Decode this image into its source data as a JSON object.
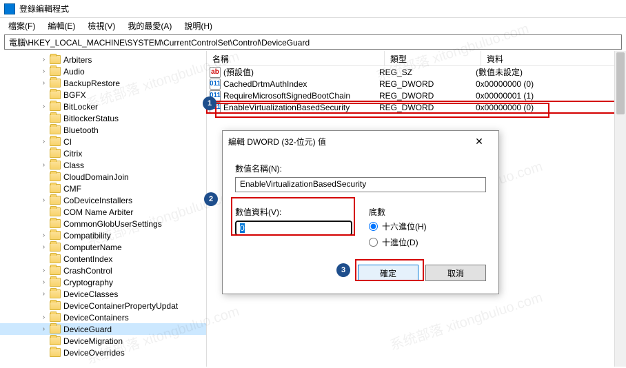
{
  "window": {
    "title": "登錄編輯程式"
  },
  "menu": {
    "file": "檔案(F)",
    "edit": "編輯(E)",
    "view": "檢視(V)",
    "favorites": "我的最愛(A)",
    "help": "說明(H)"
  },
  "path": "電腦\\HKEY_LOCAL_MACHINE\\SYSTEM\\CurrentControlSet\\Control\\DeviceGuard",
  "tree": [
    "Arbiters",
    "Audio",
    "BackupRestore",
    "BGFX",
    "BitLocker",
    "BitlockerStatus",
    "Bluetooth",
    "CI",
    "Citrix",
    "Class",
    "CloudDomainJoin",
    "CMF",
    "CoDeviceInstallers",
    "COM Name Arbiter",
    "CommonGlobUserSettings",
    "Compatibility",
    "ComputerName",
    "ContentIndex",
    "CrashControl",
    "Cryptography",
    "DeviceClasses",
    "DeviceContainerPropertyUpdat",
    "DeviceContainers",
    "DeviceGuard",
    "DeviceMigration",
    "DeviceOverrides"
  ],
  "tree_selected_index": 23,
  "list": {
    "headers": {
      "name": "名稱",
      "type": "類型",
      "data": "資料"
    },
    "rows": [
      {
        "icon": "sz",
        "name": "(預設值)",
        "type": "REG_SZ",
        "data": "(數值未設定)"
      },
      {
        "icon": "dw",
        "name": "CachedDrtmAuthIndex",
        "type": "REG_DWORD",
        "data": "0x00000000 (0)"
      },
      {
        "icon": "dw",
        "name": "RequireMicrosoftSignedBootChain",
        "type": "REG_DWORD",
        "data": "0x00000001 (1)"
      },
      {
        "icon": "dw",
        "name": "EnableVirtualizationBasedSecurity",
        "type": "REG_DWORD",
        "data": "0x00000000 (0)",
        "highlight": true
      }
    ]
  },
  "dialog": {
    "title": "編輯 DWORD (32-位元) 值",
    "name_label": "數值名稱(N):",
    "name_value": "EnableVirtualizationBasedSecurity",
    "data_label": "數值資料(V):",
    "data_value": "0",
    "base_label": "底數",
    "radio_hex": "十六進位(H)",
    "radio_dec": "十進位(D)",
    "base_selected": "hex",
    "ok": "確定",
    "cancel": "取消"
  },
  "annotations": {
    "marker1": "1",
    "marker2": "2",
    "marker3": "3"
  },
  "watermark": "系统部落 xitongbuluo.com"
}
